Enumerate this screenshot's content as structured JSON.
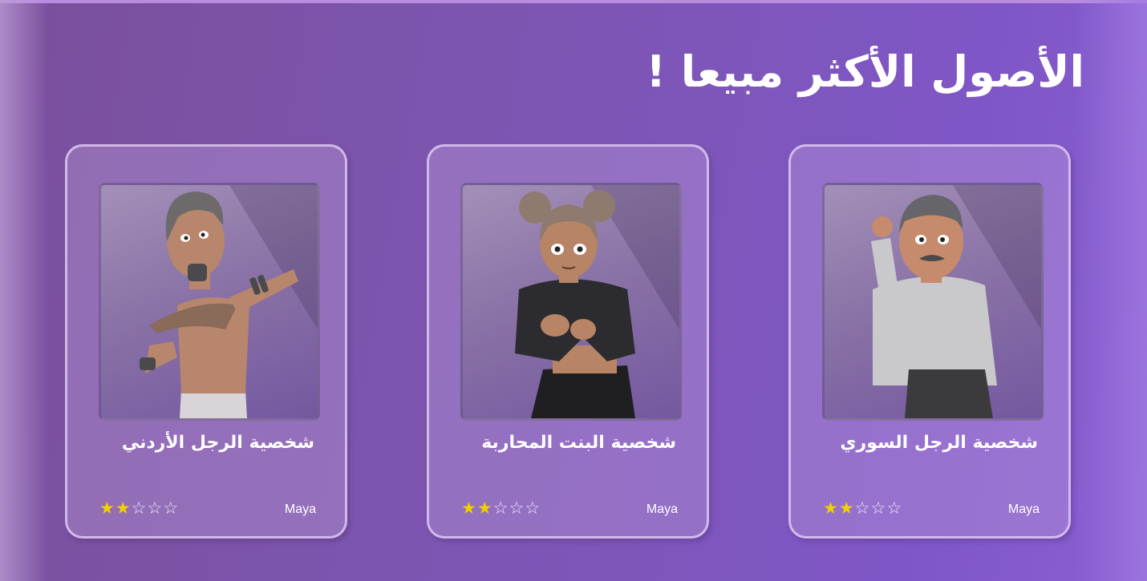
{
  "section": {
    "title": "الأصول الأكثر مبيعا !"
  },
  "colors": {
    "accent": "#7f56c6",
    "star_filled": "#f0d000"
  },
  "assets": [
    {
      "title": "شخصية الرجل السوري",
      "author": "Maya",
      "rating": 2,
      "max_rating": 5,
      "stars": [
        "★",
        "★",
        "☆",
        "☆",
        "☆"
      ],
      "thumbnail_icon": "syrian-man-character"
    },
    {
      "title": "شخصية البنت المحاربة",
      "author": "Maya",
      "rating": 2,
      "max_rating": 5,
      "stars": [
        "★",
        "★",
        "☆",
        "☆",
        "☆"
      ],
      "thumbnail_icon": "warrior-girl-character"
    },
    {
      "title": "شخصية الرجل الأردني",
      "author": "Maya",
      "rating": 2,
      "max_rating": 5,
      "stars": [
        "★",
        "★",
        "☆",
        "☆",
        "☆"
      ],
      "thumbnail_icon": "jordanian-man-character"
    }
  ]
}
